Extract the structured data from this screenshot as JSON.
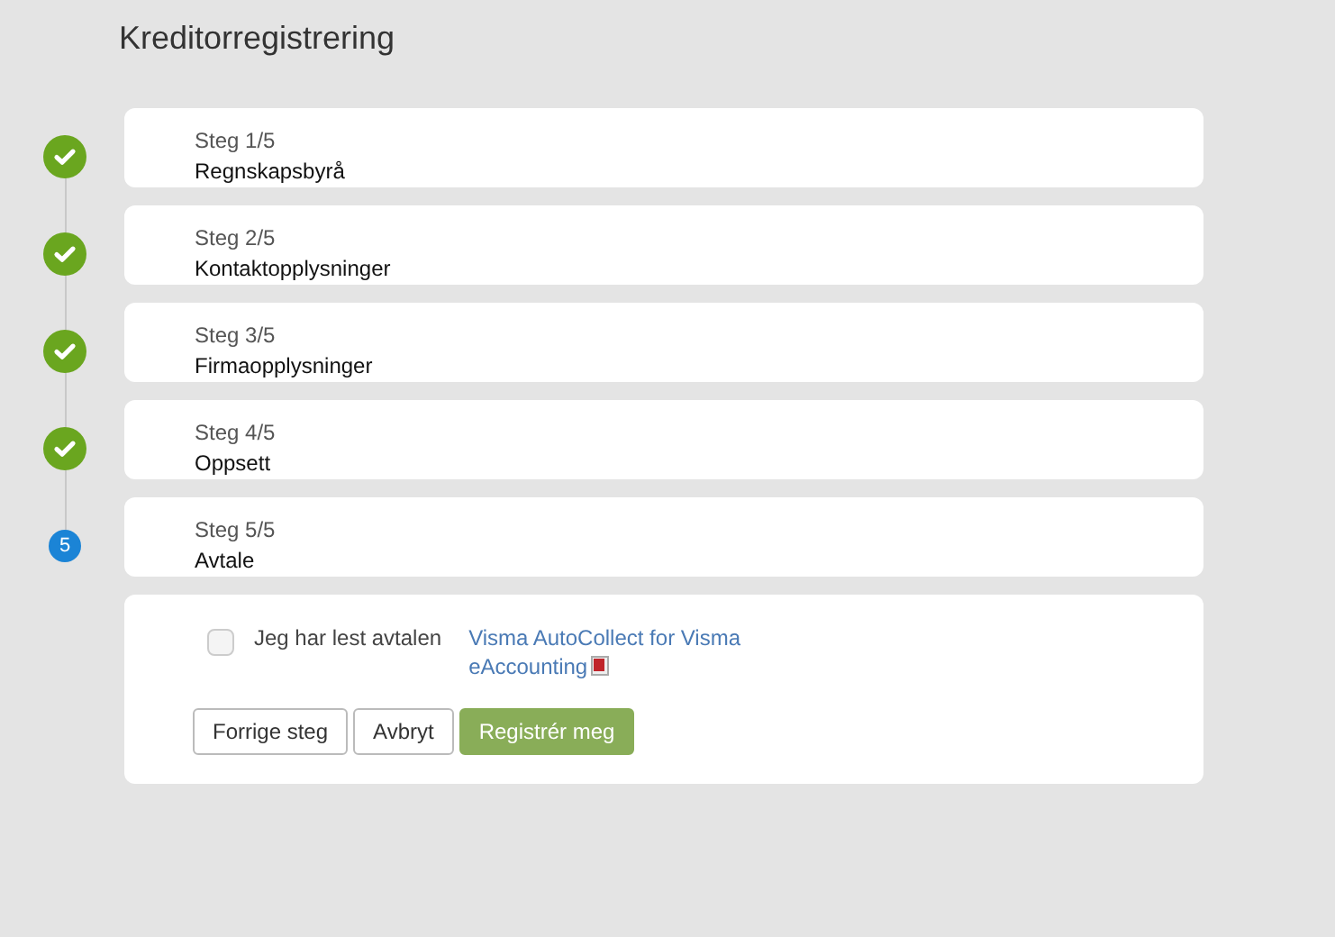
{
  "title": "Kreditorregistrering",
  "steps": [
    {
      "step": "Steg 1/5",
      "name": "Regnskapsbyrå",
      "completed": true
    },
    {
      "step": "Steg 2/5",
      "name": "Kontaktopplysninger",
      "completed": true
    },
    {
      "step": "Steg 3/5",
      "name": "Firmaopplysninger",
      "completed": true
    },
    {
      "step": "Steg 4/5",
      "name": "Oppsett",
      "completed": true
    },
    {
      "step": "Steg 5/5",
      "name": "Avtale",
      "completed": false,
      "number": "5"
    }
  ],
  "agreement": {
    "label": "Jeg har lest avtalen",
    "checked": false,
    "link": "Visma AutoCollect for Visma eAccounting"
  },
  "buttons": [
    {
      "label": "Forrige steg",
      "kind": "secondary"
    },
    {
      "label": "Avbryt",
      "kind": "secondary"
    },
    {
      "label": "Registrér meg",
      "kind": "primary"
    }
  ]
}
